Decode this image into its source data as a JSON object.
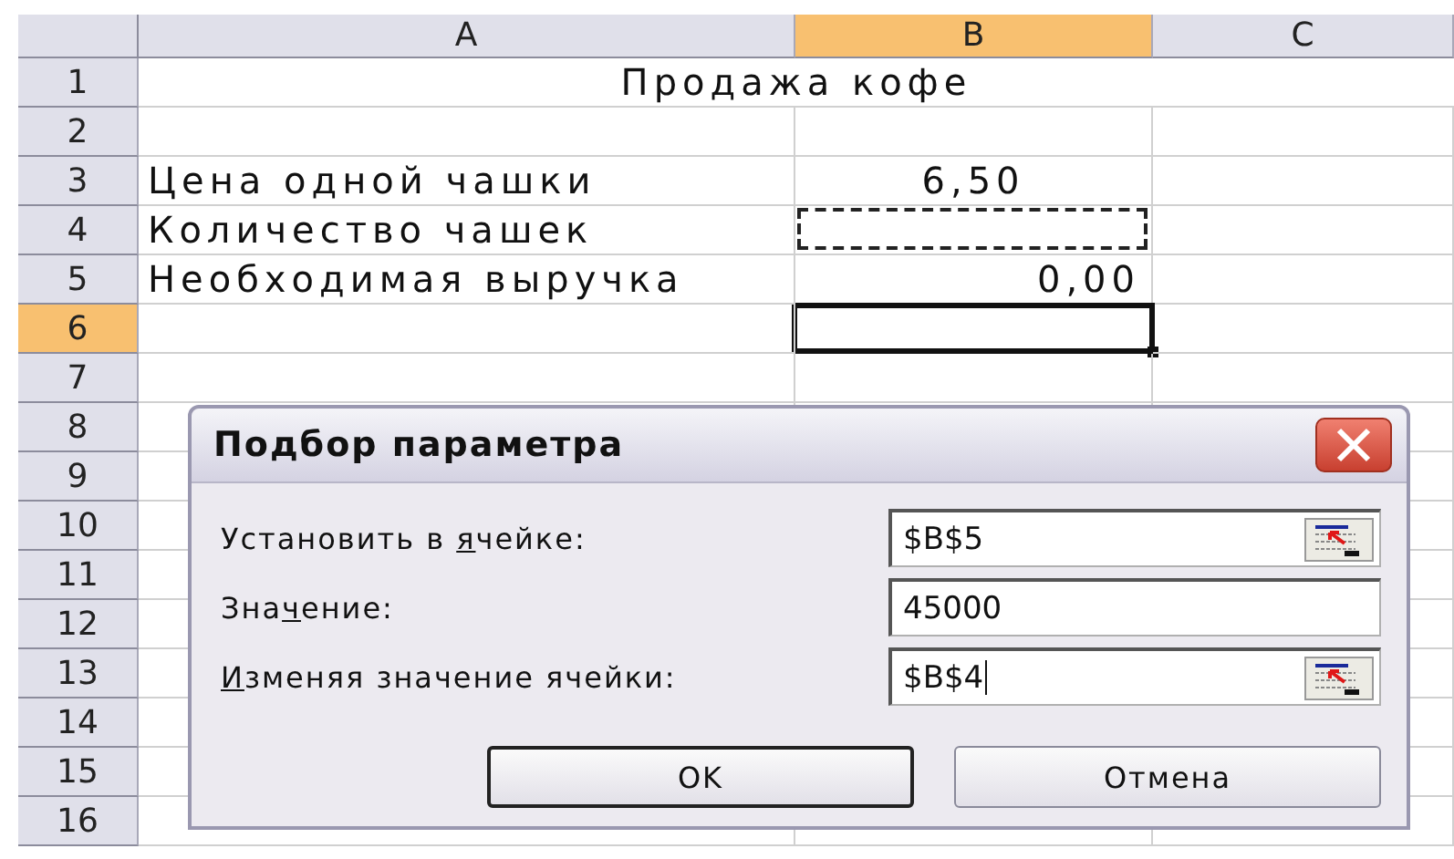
{
  "columns": [
    {
      "label": "A",
      "selected": false
    },
    {
      "label": "B",
      "selected": true
    },
    {
      "label": "C",
      "selected": false
    }
  ],
  "rows": [
    {
      "label": "1",
      "selected": false,
      "marquee": false,
      "active": false,
      "cells": [
        {
          "kind": "title",
          "text": "Продажа кофе"
        }
      ]
    },
    {
      "label": "2",
      "selected": false,
      "marquee": false,
      "active": false
    },
    {
      "label": "3",
      "selected": false,
      "marquee": false,
      "active": false,
      "cells": [
        {
          "kind": "label",
          "text": "Цена одной чашки"
        },
        {
          "kind": "center",
          "text": "6,50"
        }
      ]
    },
    {
      "label": "4",
      "selected": false,
      "marquee": true,
      "active": false,
      "cells": [
        {
          "kind": "label",
          "text": "Количество чашек"
        }
      ]
    },
    {
      "label": "5",
      "selected": false,
      "marquee": false,
      "active": false,
      "cells": [
        {
          "kind": "label",
          "text": "Необходимая выручка"
        },
        {
          "kind": "number",
          "text": "0,00"
        }
      ]
    },
    {
      "label": "6",
      "selected": true,
      "marquee": false,
      "active": true
    },
    {
      "label": "7",
      "selected": false,
      "marquee": false,
      "active": false
    },
    {
      "label": "8",
      "selected": false,
      "marquee": false,
      "active": false
    },
    {
      "label": "9",
      "selected": false,
      "marquee": false,
      "active": false
    },
    {
      "label": "10",
      "selected": false,
      "marquee": false,
      "active": false
    },
    {
      "label": "11",
      "selected": false,
      "marquee": false,
      "active": false
    },
    {
      "label": "12",
      "selected": false,
      "marquee": false,
      "active": false
    },
    {
      "label": "13",
      "selected": false,
      "marquee": false,
      "active": false
    },
    {
      "label": "14",
      "selected": false,
      "marquee": false,
      "active": false
    },
    {
      "label": "15",
      "selected": false,
      "marquee": false,
      "active": false
    },
    {
      "label": "16",
      "selected": false,
      "marquee": false,
      "active": false
    }
  ],
  "dialog": {
    "title": "Подбор параметра",
    "fields": [
      {
        "pre": "Установить в ",
        "key": "я",
        "post": "чейке:",
        "value": "$B$5",
        "picker": true,
        "caret": false
      },
      {
        "pre": "Зна",
        "key": "ч",
        "post": "ение:",
        "value": "45000",
        "picker": false,
        "caret": false
      },
      {
        "key": "И",
        "post": "зменяя значение ячейки:",
        "value": "$B$4",
        "picker": true,
        "caret": true
      }
    ],
    "buttons": [
      {
        "label": "OK",
        "default": true
      },
      {
        "label": "Отмена",
        "default": false
      }
    ]
  }
}
